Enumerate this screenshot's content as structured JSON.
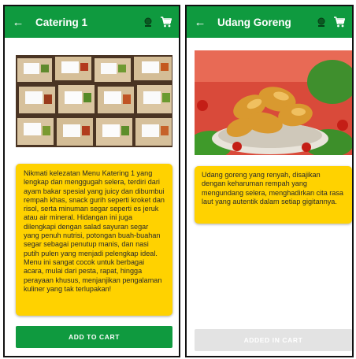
{
  "screens": [
    {
      "title": "Catering 1",
      "description": "Nikmati kelezatan Menu Katering 1 yang lengkap dan menggugah selera, terdiri dari ayam bakar spesial yang juicy dan dibumbui rempah khas, snack gurih seperti kroket dan risol, serta minuman segar seperti es jeruk atau air mineral. Hidangan ini juga dilengkapi dengan salad sayuran segar yang penuh nutrisi, potongan buah-buahan segar sebagai penutup manis, dan nasi putih pulen yang menjadi pelengkap ideal. Menu ini sangat cocok untuk berbagai acara, mulai dari pesta, rapat, hingga perayaan khusus, menjanjikan pengalaman kuliner yang tak terlupakan!",
      "button_label": "ADD TO CART",
      "button_state": "enabled"
    },
    {
      "title": "Udang Goreng",
      "description": "Udang goreng yang renyah, disajikan dengan keharuman rempah yang mengundang selera, menghadirkan cita rasa laut yang autentik dalam setiap gigitannya.",
      "button_label": "ADDED IN CART",
      "button_state": "disabled"
    }
  ],
  "icons": {
    "back": "arrow-left-icon",
    "status": "status-indicator-icon",
    "cart": "shopping-cart-icon"
  },
  "colors": {
    "primary_green": "#0f9a3f",
    "description_yellow": "#ffd200",
    "disabled_gray": "#e3e3e3"
  }
}
